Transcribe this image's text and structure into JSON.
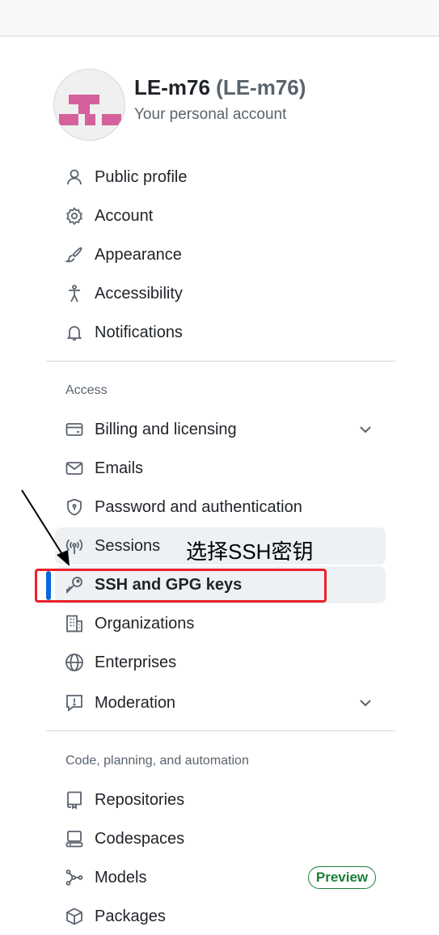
{
  "account": {
    "name": "LE-m76",
    "handle": "(LE-m76)",
    "subtitle": "Your personal account"
  },
  "nav_main": [
    {
      "label": "Public profile",
      "icon": "person-icon"
    },
    {
      "label": "Account",
      "icon": "gear-icon"
    },
    {
      "label": "Appearance",
      "icon": "paintbrush-icon"
    },
    {
      "label": "Accessibility",
      "icon": "accessibility-icon"
    },
    {
      "label": "Notifications",
      "icon": "bell-icon"
    }
  ],
  "sections": {
    "access": "Access",
    "code": "Code, planning, and automation"
  },
  "nav_access": [
    {
      "label": "Billing and licensing",
      "icon": "credit-card-icon",
      "expandable": true
    },
    {
      "label": "Emails",
      "icon": "mail-icon"
    },
    {
      "label": "Password and authentication",
      "icon": "shield-lock-icon"
    },
    {
      "label": "Sessions",
      "icon": "broadcast-icon"
    },
    {
      "label": "SSH and GPG keys",
      "icon": "key-icon",
      "active": true
    },
    {
      "label": "Organizations",
      "icon": "organization-icon"
    },
    {
      "label": "Enterprises",
      "icon": "globe-icon"
    },
    {
      "label": "Moderation",
      "icon": "report-icon",
      "expandable": true
    }
  ],
  "nav_code": [
    {
      "label": "Repositories",
      "icon": "repo-icon"
    },
    {
      "label": "Codespaces",
      "icon": "codespaces-icon"
    },
    {
      "label": "Models",
      "icon": "models-icon",
      "badge": "Preview"
    },
    {
      "label": "Packages",
      "icon": "package-icon"
    }
  ],
  "annotation": {
    "text": "选择SSH密钥",
    "color": "#e8212b"
  },
  "colors": {
    "accent": "#0969da",
    "badge": "#1a7f37",
    "avatar_pink": "#d4619b"
  }
}
